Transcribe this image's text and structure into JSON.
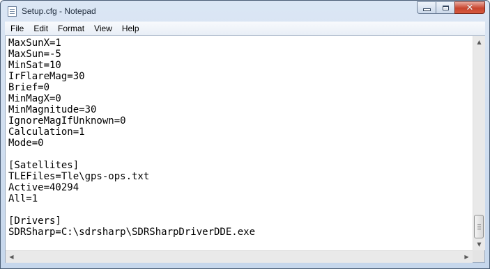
{
  "window": {
    "title": "Setup.cfg - Notepad"
  },
  "menu": [
    "File",
    "Edit",
    "Format",
    "View",
    "Help"
  ],
  "editor": {
    "lines": [
      "MaxSunX=1",
      "MaxSun=-5",
      "MinSat=10",
      "IrFlareMag=30",
      "Brief=0",
      "MinMagX=0",
      "MinMagnitude=30",
      "IgnoreMagIfUnknown=0",
      "Calculation=1",
      "Mode=0",
      "",
      "[Satellites]",
      "TLEFiles=Tle\\gps-ops.txt",
      "Active=40294",
      "All=1",
      "",
      "[Drivers]",
      "SDRSharp=C:\\sdrsharp\\SDRSharpDriverDDE.exe"
    ]
  },
  "icons": {
    "app": "notepad-icon",
    "minimize": "minimize-icon",
    "maximize": "maximize-icon",
    "close": "close-icon",
    "scroll_up": "arrow-up-icon",
    "scroll_down": "arrow-down-icon",
    "scroll_left": "arrow-left-icon",
    "scroll_right": "arrow-right-icon"
  },
  "colors": {
    "close_button": "#c8452f",
    "title_bar": "#c6d7ec"
  }
}
